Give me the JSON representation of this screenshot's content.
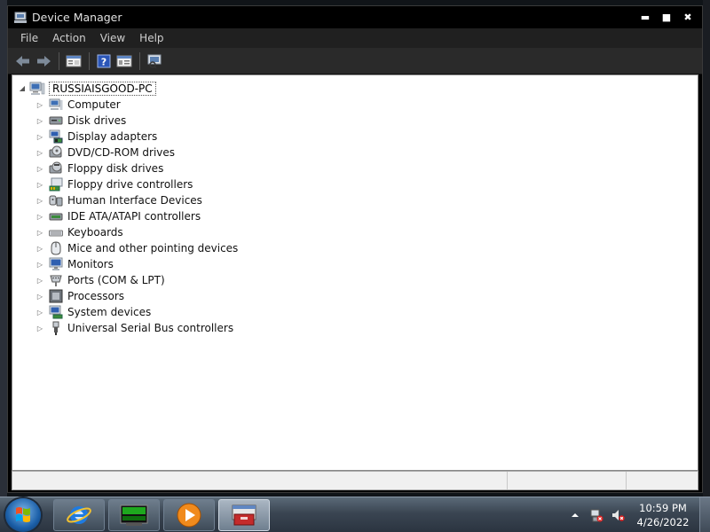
{
  "window": {
    "title": "Device Manager"
  },
  "title_controls": {
    "minimize": "▬",
    "maximize": "■",
    "close": "✖"
  },
  "menu": [
    "File",
    "Action",
    "View",
    "Help"
  ],
  "toolbar": [
    {
      "name": "back-arrow-icon"
    },
    {
      "name": "forward-arrow-icon"
    },
    {
      "name": "properties-icon"
    },
    {
      "name": "help-icon"
    },
    {
      "name": "console-tree-icon"
    },
    {
      "name": "scan-hardware-icon"
    }
  ],
  "tree": {
    "root": "RUSSIAISGOOD-PC",
    "items": [
      {
        "label": "Computer",
        "icon": "computer-icon"
      },
      {
        "label": "Disk drives",
        "icon": "disk-drive-icon"
      },
      {
        "label": "Display adapters",
        "icon": "display-adapter-icon"
      },
      {
        "label": "DVD/CD-ROM drives",
        "icon": "dvd-drive-icon"
      },
      {
        "label": "Floppy disk drives",
        "icon": "floppy-disk-icon"
      },
      {
        "label": "Floppy drive controllers",
        "icon": "floppy-controller-icon"
      },
      {
        "label": "Human Interface Devices",
        "icon": "hid-icon"
      },
      {
        "label": "IDE ATA/ATAPI controllers",
        "icon": "ide-controller-icon"
      },
      {
        "label": "Keyboards",
        "icon": "keyboard-icon"
      },
      {
        "label": "Mice and other pointing devices",
        "icon": "mouse-icon"
      },
      {
        "label": "Monitors",
        "icon": "monitor-icon"
      },
      {
        "label": "Ports (COM & LPT)",
        "icon": "ports-icon"
      },
      {
        "label": "Processors",
        "icon": "processor-icon"
      },
      {
        "label": "System devices",
        "icon": "system-devices-icon"
      },
      {
        "label": "Universal Serial Bus controllers",
        "icon": "usb-icon"
      }
    ]
  },
  "taskbar": {
    "pinned": [
      {
        "name": "internet-explorer-icon"
      },
      {
        "name": "terminal-icon"
      },
      {
        "name": "media-player-icon"
      },
      {
        "name": "device-manager-task-icon"
      }
    ],
    "tray": {
      "time": "10:59 PM",
      "date": "4/26/2022"
    }
  },
  "colors": {
    "window_frame": "#000000",
    "menubar": "#202020",
    "toolbar": "#2a2a2a",
    "content_bg": "#ffffff",
    "taskbar": "#3a4552"
  }
}
